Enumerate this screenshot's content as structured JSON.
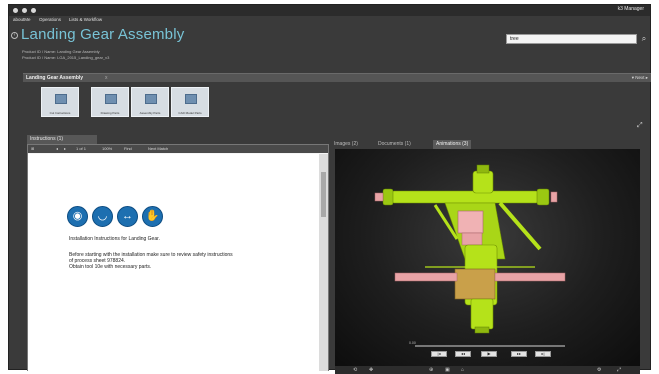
{
  "titlebar": {
    "user": "k3 Manager",
    "window_buttons": [
      "close",
      "minimize",
      "maximize"
    ]
  },
  "menu": {
    "items": [
      "aboutMe",
      "Operations",
      "Lists & Workflow"
    ]
  },
  "header": {
    "back_icon": "back-arrow-icon",
    "title": "Landing Gear Assembly",
    "subline1": "Product ID / Name: Landing Gear Assembly",
    "subline2": "Product ID / Name: LGA_2015_Landing_gear_v3",
    "search_value": "tree",
    "search_icon": "search-icon"
  },
  "section": {
    "title": "Landing Gear Assembly",
    "close": "x",
    "right_label": "▾ Next ▸"
  },
  "thumbnails": [
    {
      "label": "Cut Instructions"
    },
    {
      "label": "Drawing Parts"
    },
    {
      "label": "Assembly Parts"
    },
    {
      "label": "CAD Model Parts"
    }
  ],
  "left_pane": {
    "tab": "Instructions (1)",
    "toolbar": [
      "⊞",
      "◂",
      "▸",
      "1 of 1",
      "100%",
      "Find",
      "Next Match"
    ],
    "doc": {
      "line1": "Installation Instructions for Landing Gear.",
      "line2": "Before starting with the installation make sure to review safety instructions",
      "line3": "of process sheet 978824.",
      "line4": "Obtain tool 10e with necessary parts."
    },
    "safety_icons": [
      "eye-protection-icon",
      "hearing-protection-icon",
      "ear-muff-icon",
      "gloves-icon"
    ]
  },
  "right_pane": {
    "tabs": [
      {
        "label": "Images (2)",
        "active": false
      },
      {
        "label": "Documents (1)",
        "active": false
      },
      {
        "label": "Animations (3)",
        "active": true
      }
    ],
    "timeline_label": "0.00",
    "controls": [
      "|◂",
      "◂◂",
      "▶",
      "▸▸",
      "▸|"
    ],
    "bottom_icons": [
      "rotate-icon",
      "pan-icon",
      "zoom-icon",
      "fit-icon",
      "home-icon",
      "settings-icon",
      "fullscreen-icon"
    ]
  },
  "colors": {
    "background": "#3a3a3a",
    "title": "#78c3d6",
    "model_green": "#b5e21a",
    "model_pink": "#e8a3a6"
  }
}
